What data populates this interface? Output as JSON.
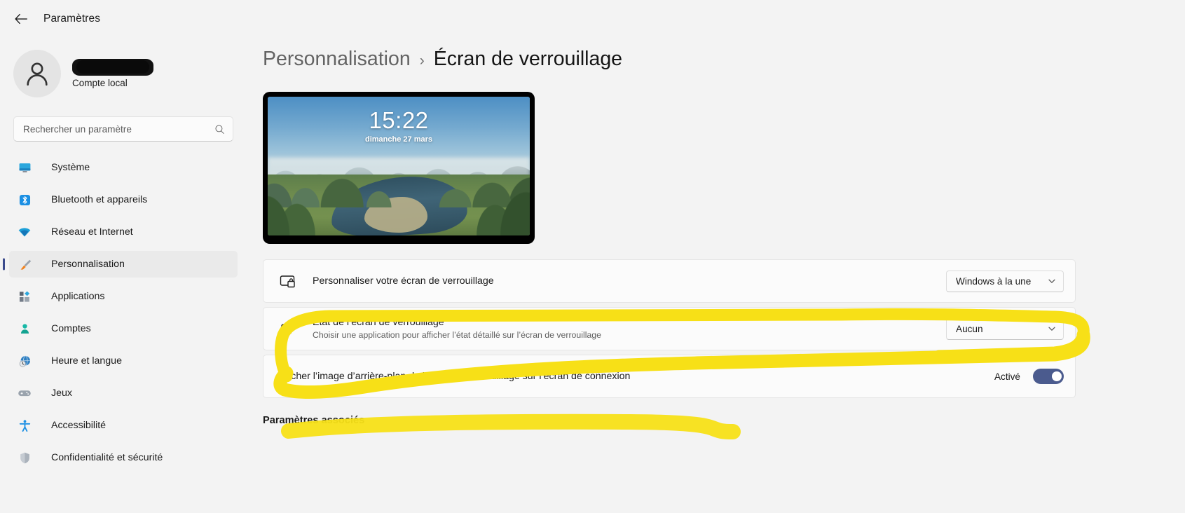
{
  "window": {
    "title": "Paramètres",
    "back_icon": "back-arrow-icon"
  },
  "sidebar": {
    "account": {
      "name_redacted": "",
      "account_type": "Compte local",
      "avatar_icon": "person-avatar-icon"
    },
    "search": {
      "placeholder": "Rechercher un paramètre",
      "value": "",
      "icon": "search-icon"
    },
    "items": [
      {
        "label": "Système",
        "icon": "monitor-icon",
        "active": false
      },
      {
        "label": "Bluetooth et appareils",
        "icon": "bluetooth-icon",
        "active": false
      },
      {
        "label": "Réseau et Internet",
        "icon": "wifi-icon",
        "active": false
      },
      {
        "label": "Personnalisation",
        "icon": "paintbrush-icon",
        "active": true
      },
      {
        "label": "Applications",
        "icon": "apps-icon",
        "active": false
      },
      {
        "label": "Comptes",
        "icon": "account-person-icon",
        "active": false
      },
      {
        "label": "Heure et langue",
        "icon": "clock-globe-icon",
        "active": false
      },
      {
        "label": "Jeux",
        "icon": "gamepad-icon",
        "active": false
      },
      {
        "label": "Accessibilité",
        "icon": "accessibility-person-icon",
        "active": false
      },
      {
        "label": "Confidentialité et sécurité",
        "icon": "shield-icon",
        "active": false
      }
    ]
  },
  "main": {
    "breadcrumb": {
      "parent": "Personnalisation",
      "separator": "›",
      "current": "Écran de verrouillage"
    },
    "preview": {
      "time": "15:22",
      "date": "dimanche 27 mars",
      "wallpaper_description": "paysage de montagnes karstiques et rivière"
    },
    "rows": [
      {
        "icon": "lock-screen-icon",
        "title": "Personnaliser votre écran de verrouillage",
        "subtitle": "",
        "control": "dropdown",
        "value": "Windows à la une",
        "chevron": "chevron-down-icon"
      },
      {
        "icon": "lock-screen-status-icon",
        "title": "État de l’écran de verrouillage",
        "subtitle": "Choisir une application pour afficher l’état détaillé sur l’écran de verrouillage",
        "control": "dropdown",
        "value": "Aucun",
        "chevron": "chevron-down-icon"
      },
      {
        "icon": "",
        "title": "Afficher l’image d’arrière-plan de l’écran de verrouillage sur l’écran de connexion",
        "subtitle": "",
        "control": "toggle",
        "value": "Activé",
        "toggle_on": true
      }
    ],
    "related_settings_title": "Paramètres associés"
  },
  "annotation": {
    "type": "highlighter-marker",
    "color": "#f7e017",
    "targets": [
      "row-lock-screen-status",
      "row-show-background-on-signin"
    ]
  },
  "colors": {
    "app_background": "#f3f3f3",
    "card_background": "#fbfbfb",
    "accent_toggle": "#4b5b8e",
    "nav_active_indicator": "#3b4a8c",
    "highlight_yellow": "#f7e017",
    "text_primary": "#1b1b1b",
    "text_secondary": "#5f5f5f"
  }
}
